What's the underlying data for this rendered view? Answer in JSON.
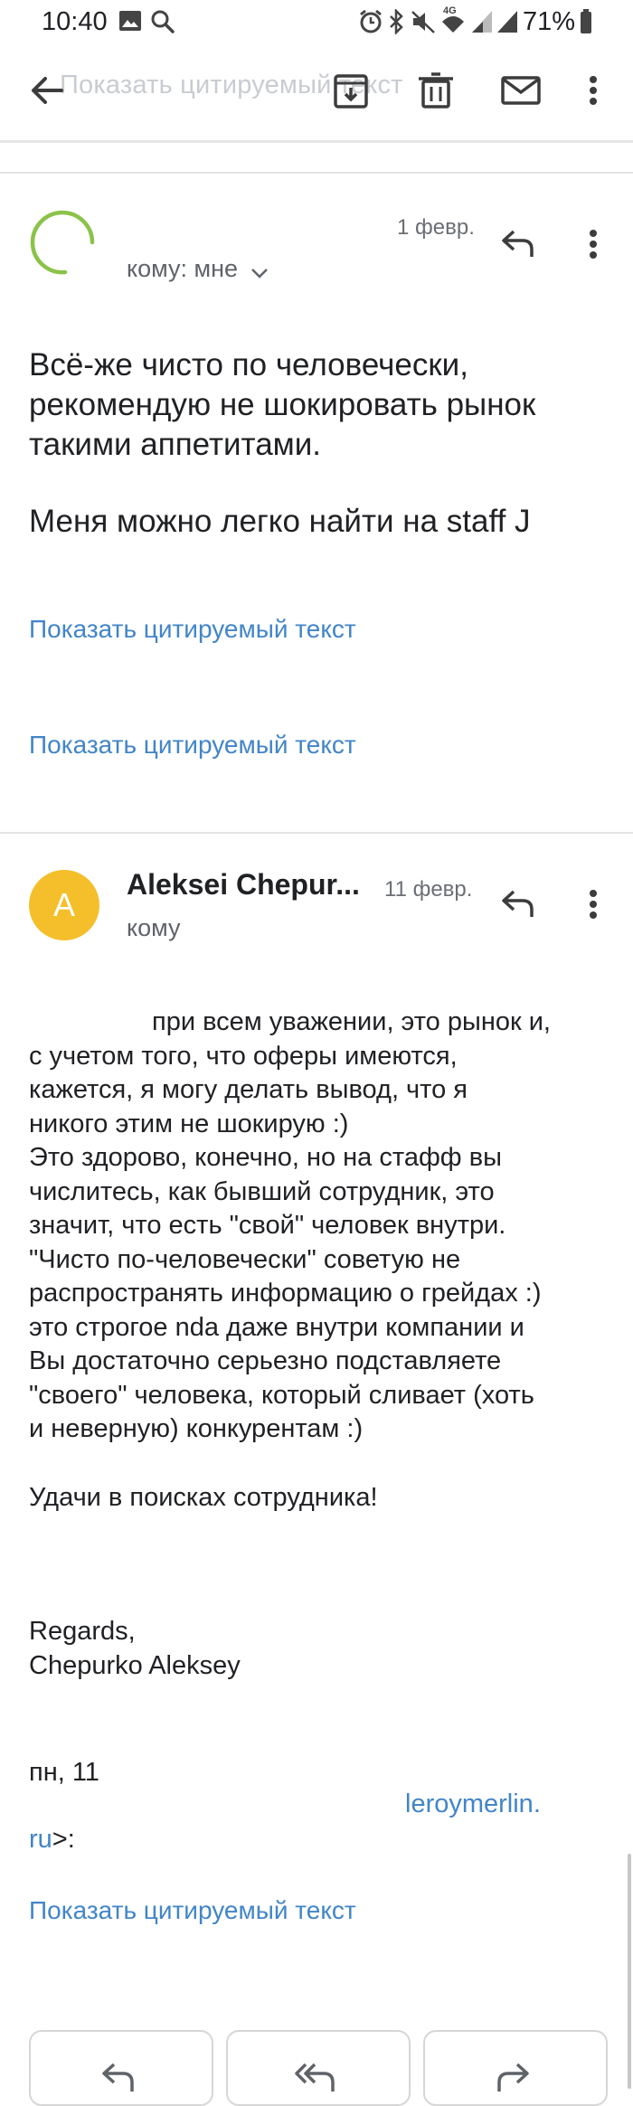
{
  "status_bar": {
    "time": "10:40",
    "battery": "71%",
    "network": "4G"
  },
  "app_bar": {
    "faded_link": "Показать цитируемый текст"
  },
  "message1": {
    "date": "1 февр.",
    "to": "кому: мне",
    "line1": "Всё-же чисто по человечески,",
    "line2": "рекомендую не шокировать рынок",
    "line3": "такими аппетитами.",
    "line4": "Меня можно легко найти на staff J",
    "quote1": "Показать цитируемый текст",
    "quote2": "Показать цитируемый текст"
  },
  "message2": {
    "avatar_letter": "A",
    "avatar_color": "#f4bf2a",
    "sender": "Aleksei Chepur...",
    "date": "11 февр.",
    "to": "кому",
    "lines": [
      "при всем уважении, это рынок и,",
      "с учетом того, что оферы имеются,",
      "кажется, я могу делать вывод, что я",
      "никого этим не шокирую :)",
      "Это здорово, конечно, но на стафф вы",
      "числитесь, как бывший сотрудник, это",
      "значит, что есть \"свой\" человек внутри.",
      "\"Чисто по-человечески\" советую не",
      "распространять информацию о грейдах :)",
      "это строгое nda даже внутри компании и",
      "Вы достаточно серьезно подставляете",
      "\"своего\" человека, который сливает (хоть",
      "и неверную) конкурентам :)"
    ],
    "farewell": "Удачи в поисках сотрудника!",
    "regards": "Regards,",
    "signature": "Chepurko Aleksey",
    "quote_date_prefix": "пн, 11",
    "email_fragment": "leroymerlin.",
    "email_end_link": "ru",
    "email_end_text": ">:",
    "quote": "Показать цитируемый текст"
  },
  "colors": {
    "link": "#4285c9",
    "accent_green": "#8bc34a"
  }
}
